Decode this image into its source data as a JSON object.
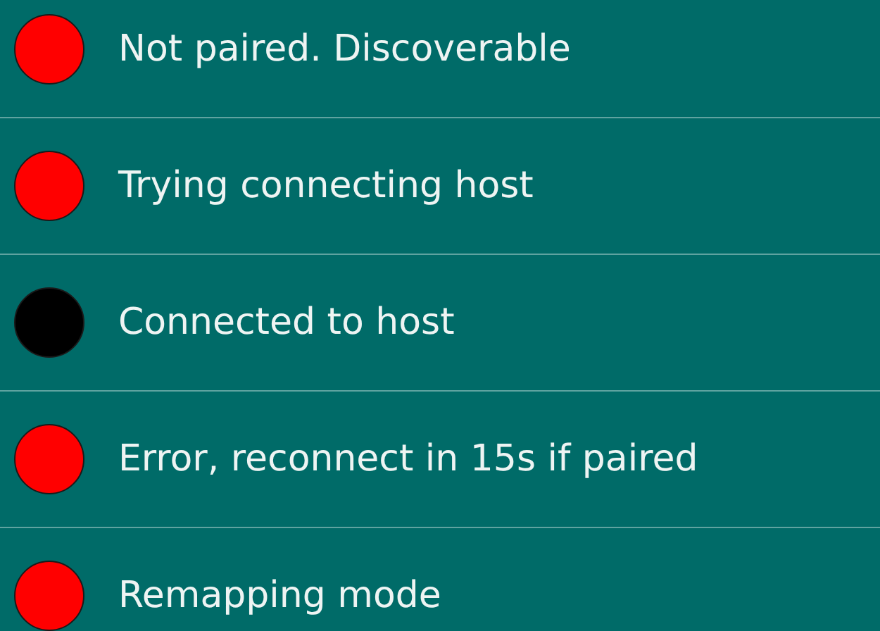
{
  "states": [
    {
      "label": "Not paired. Discoverable",
      "color": "#ff0000"
    },
    {
      "label": "Trying connecting host",
      "color": "#ff0000"
    },
    {
      "label": "Connected to host",
      "color": "#000000"
    },
    {
      "label": "Error, reconnect in 15s if paired",
      "color": "#ff0000"
    },
    {
      "label": "Remapping mode",
      "color": "#ff0000"
    }
  ]
}
